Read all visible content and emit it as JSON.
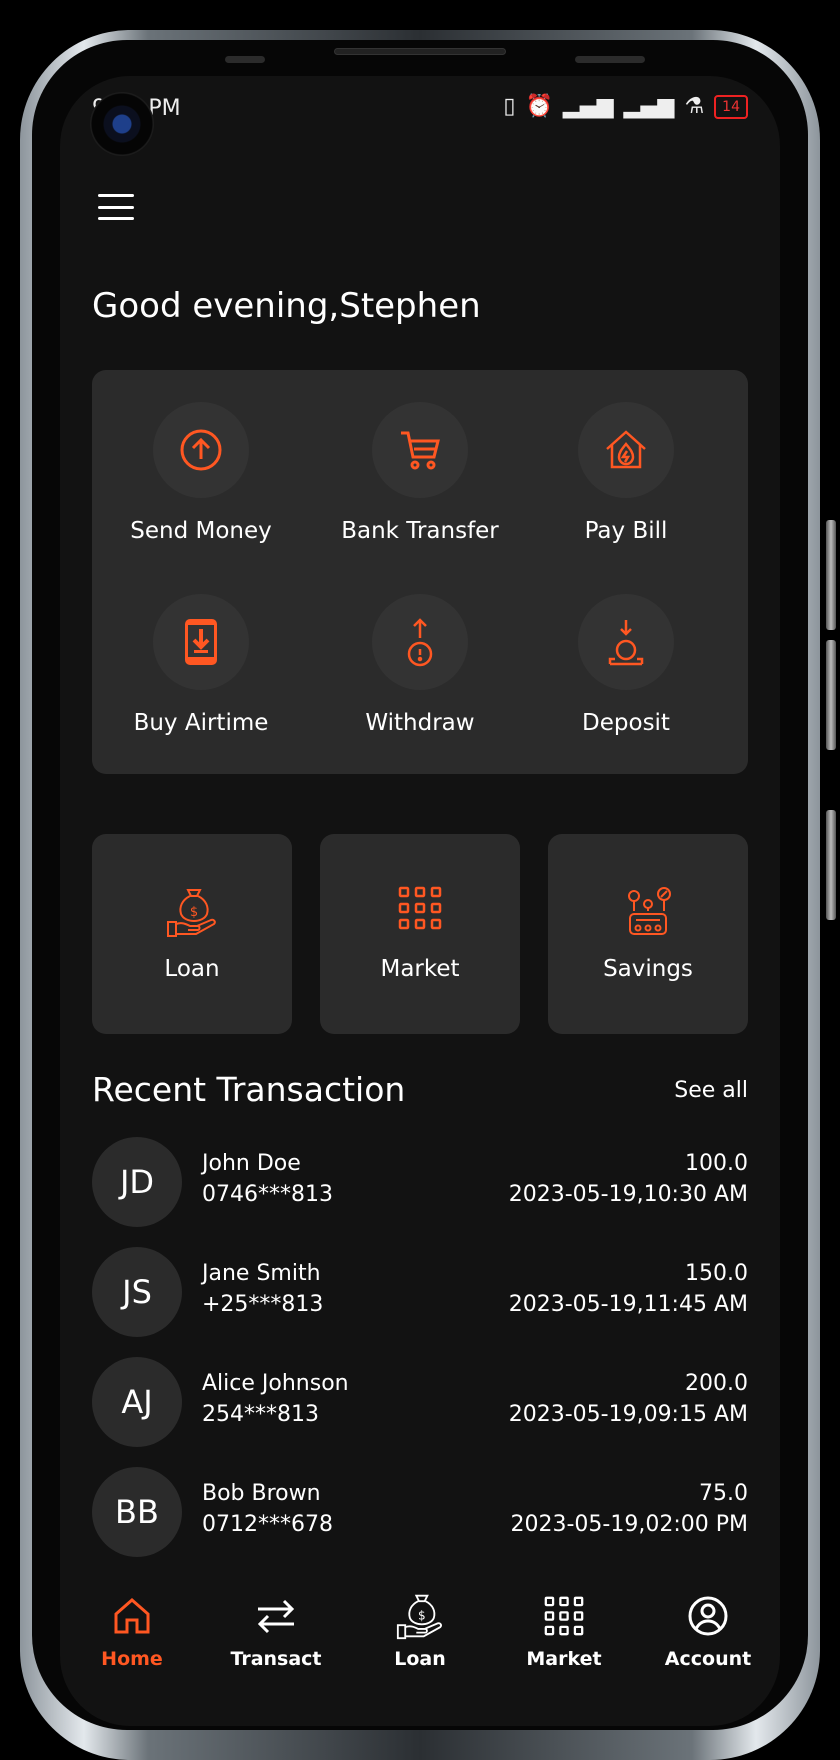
{
  "accent_color": "#ff5722",
  "status_bar": {
    "time": "9:57 PM",
    "battery": "14"
  },
  "greeting": "Good evening,Stephen",
  "actions": [
    {
      "label": "Send Money",
      "icon": "arrow-up-circle-icon"
    },
    {
      "label": "Bank Transfer",
      "icon": "cart-icon"
    },
    {
      "label": "Pay Bill",
      "icon": "house-flame-icon"
    },
    {
      "label": "Buy Airtime",
      "icon": "phone-download-icon"
    },
    {
      "label": "Withdraw",
      "icon": "withdraw-icon"
    },
    {
      "label": "Deposit",
      "icon": "deposit-icon"
    }
  ],
  "tiles": [
    {
      "label": "Loan",
      "icon": "money-bag-hand-icon"
    },
    {
      "label": "Market",
      "icon": "grid-icon"
    },
    {
      "label": "Savings",
      "icon": "savings-icon"
    }
  ],
  "recent": {
    "title": "Recent Transaction",
    "see_all": "See all",
    "items": [
      {
        "initials": "JD",
        "name": "John Doe",
        "phone": "0746***813",
        "amount": "100.0",
        "date": "2023-05-19,10:30 AM"
      },
      {
        "initials": "JS",
        "name": "Jane Smith",
        "phone": "+25***813",
        "amount": "150.0",
        "date": "2023-05-19,11:45 AM"
      },
      {
        "initials": "AJ",
        "name": "Alice Johnson",
        "phone": "254***813",
        "amount": "200.0",
        "date": "2023-05-19,09:15 AM"
      },
      {
        "initials": "BB",
        "name": "Bob Brown",
        "phone": "0712***678",
        "amount": "75.0",
        "date": "2023-05-19,02:00 PM"
      }
    ]
  },
  "nav": [
    {
      "label": "Home",
      "icon": "home-icon",
      "active": true
    },
    {
      "label": "Transact",
      "icon": "transfer-arrows-icon"
    },
    {
      "label": "Loan",
      "icon": "money-bag-hand-icon"
    },
    {
      "label": "Market",
      "icon": "grid-icon"
    },
    {
      "label": "Account",
      "icon": "user-circle-icon"
    }
  ]
}
